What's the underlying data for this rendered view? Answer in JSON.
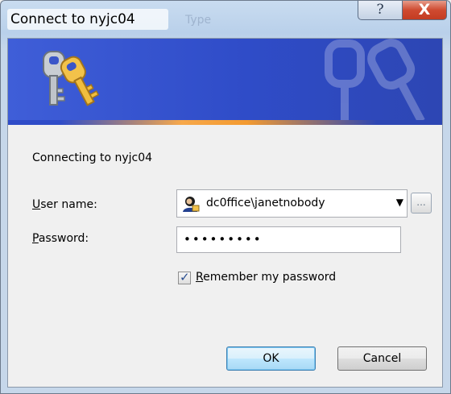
{
  "window": {
    "title": "Connect to nyjc04",
    "ghost_title": "Type",
    "help_glyph": "?",
    "close_glyph": "X"
  },
  "banner": {
    "icon": "keys-icon",
    "colors": {
      "banner": "#3355d0",
      "accent": "#f39a30"
    }
  },
  "form": {
    "connecting_text": "Connecting to nyjc04",
    "user_label_accel": "U",
    "user_label_rest": "ser name:",
    "user_value": "dc0ffice\\janetnobody",
    "user_icon": "user-account-icon",
    "browse_label": "...",
    "password_label_accel": "P",
    "password_label_rest": "assword:",
    "password_mask": "•••••••••",
    "remember_checked": true,
    "remember_label_accel": "R",
    "remember_label_rest": "emember my password"
  },
  "buttons": {
    "ok": "OK",
    "cancel": "Cancel"
  }
}
